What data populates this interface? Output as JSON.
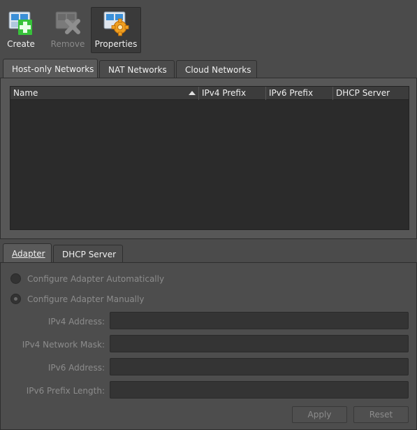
{
  "toolbar": {
    "create": {
      "label": "Create"
    },
    "remove": {
      "label": "Remove"
    },
    "properties": {
      "label": "Properties"
    }
  },
  "top_tabs": [
    {
      "label": "Host-only Networks",
      "selected": true
    },
    {
      "label": "NAT Networks",
      "selected": false
    },
    {
      "label": "Cloud Networks",
      "selected": false
    }
  ],
  "table": {
    "columns": [
      "Name",
      "IPv4 Prefix",
      "IPv6 Prefix",
      "DHCP Server"
    ],
    "sorted_column": "Name",
    "sort_direction": "ascending",
    "rows": []
  },
  "bottom_tabs": [
    {
      "label": "Adapter",
      "selected": true
    },
    {
      "label": "DHCP Server",
      "selected": false
    }
  ],
  "adapter": {
    "auto_label": "Configure Adapter Automatically",
    "manual_label": "Configure Adapter Manually",
    "selected_mode": "manual",
    "ipv4_address_label": "IPv4 Address:",
    "ipv4_address_value": "",
    "ipv4_mask_label": "IPv4 Network Mask:",
    "ipv4_mask_value": "",
    "ipv6_address_label": "IPv6 Address:",
    "ipv6_address_value": "",
    "ipv6_prefix_label": "IPv6 Prefix Length:",
    "ipv6_prefix_value": ""
  },
  "buttons": {
    "apply": "Apply",
    "reset": "Reset"
  },
  "colors": {
    "background": "#4b4b4b",
    "panel": "#575757",
    "table_bg": "#2b2b2b",
    "create_accent": "#3cc83c",
    "properties_gear": "#f0a020"
  }
}
